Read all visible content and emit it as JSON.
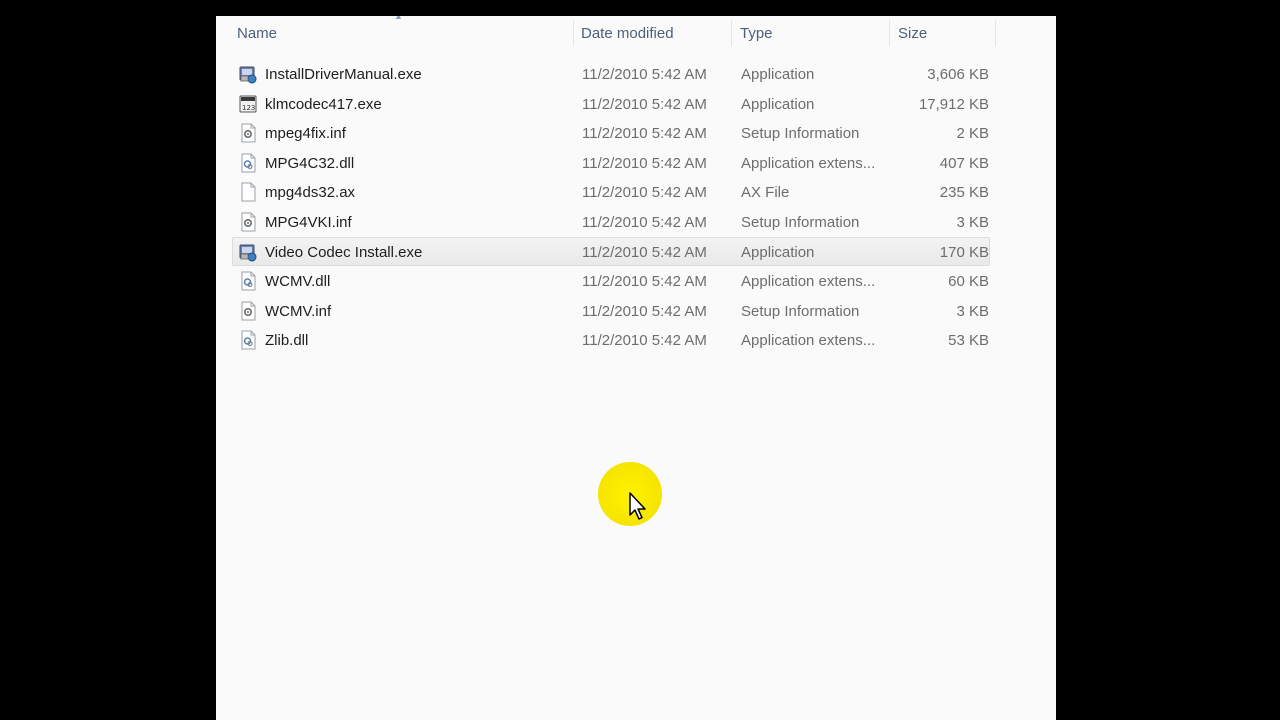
{
  "columns": {
    "name": "Name",
    "date": "Date modified",
    "type": "Type",
    "size": "Size"
  },
  "files": [
    {
      "name": "InstallDriverManual.exe",
      "date": "11/2/2010 5:42 AM",
      "type": "Application",
      "size": "3,606 KB",
      "icon": "installer-exe-icon"
    },
    {
      "name": "klmcodec417.exe",
      "date": "11/2/2010 5:42 AM",
      "type": "Application",
      "size": "17,912 KB",
      "icon": "codec-exe-icon"
    },
    {
      "name": "mpeg4fix.inf",
      "date": "11/2/2010 5:42 AM",
      "type": "Setup Information",
      "size": "2 KB",
      "icon": "setup-inf-icon"
    },
    {
      "name": "MPG4C32.dll",
      "date": "11/2/2010 5:42 AM",
      "type": "Application extens...",
      "size": "407 KB",
      "icon": "dll-file-icon"
    },
    {
      "name": "mpg4ds32.ax",
      "date": "11/2/2010 5:42 AM",
      "type": "AX File",
      "size": "235 KB",
      "icon": "blank-file-icon"
    },
    {
      "name": "MPG4VKI.inf",
      "date": "11/2/2010 5:42 AM",
      "type": "Setup Information",
      "size": "3 KB",
      "icon": "setup-inf-icon"
    },
    {
      "name": "Video Codec Install.exe",
      "date": "11/2/2010 5:42 AM",
      "type": "Application",
      "size": "170 KB",
      "icon": "installer-exe-icon"
    },
    {
      "name": "WCMV.dll",
      "date": "11/2/2010 5:42 AM",
      "type": "Application extens...",
      "size": "60 KB",
      "icon": "dll-file-icon"
    },
    {
      "name": "WCMV.inf",
      "date": "11/2/2010 5:42 AM",
      "type": "Setup Information",
      "size": "3 KB",
      "icon": "setup-inf-icon"
    },
    {
      "name": "Zlib.dll",
      "date": "11/2/2010 5:42 AM",
      "type": "Application extens...",
      "size": "53 KB",
      "icon": "dll-file-icon"
    }
  ],
  "hovered_row": 6,
  "colors": {
    "header_text": "#4c607a",
    "row_text": "#1e1e1e",
    "meta_text": "#6d6d6d",
    "cursor_highlight": "#f7e600"
  }
}
